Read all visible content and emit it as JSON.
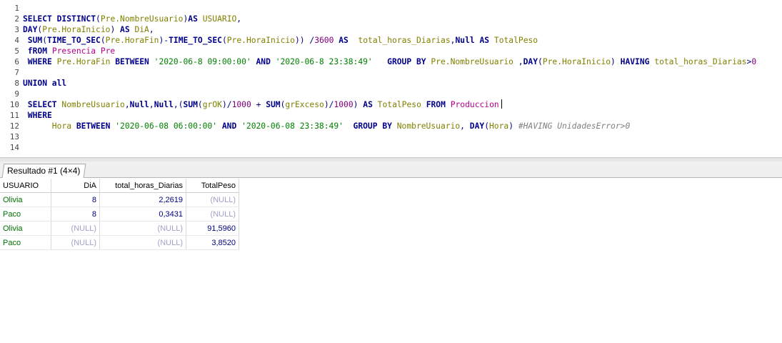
{
  "editor": {
    "line_numbers": [
      "1",
      "2",
      "3",
      "4",
      "5",
      "6",
      "7",
      "8",
      "9",
      "10",
      "11",
      "12",
      "13",
      "14"
    ],
    "lines": [
      [],
      [
        {
          "t": "SELECT ",
          "c": "kw"
        },
        {
          "t": "DISTINCT",
          "c": "kw"
        },
        {
          "t": "(",
          "c": "op"
        },
        {
          "t": "Pre.NombreUsuario",
          "c": "id"
        },
        {
          "t": ")",
          "c": "op"
        },
        {
          "t": "AS ",
          "c": "kw"
        },
        {
          "t": "USUARIO",
          "c": "id"
        },
        {
          "t": ",",
          "c": "op"
        }
      ],
      [
        {
          "t": "DAY",
          "c": "kw"
        },
        {
          "t": "(",
          "c": "op"
        },
        {
          "t": "Pre.HoraInicio",
          "c": "id"
        },
        {
          "t": ") ",
          "c": "op"
        },
        {
          "t": "AS ",
          "c": "kw"
        },
        {
          "t": "DiA",
          "c": "id"
        },
        {
          "t": ",",
          "c": "op"
        }
      ],
      [
        {
          "t": " SUM",
          "c": "kw"
        },
        {
          "t": "(",
          "c": "op"
        },
        {
          "t": "TIME_TO_SEC",
          "c": "kw"
        },
        {
          "t": "(",
          "c": "op"
        },
        {
          "t": "Pre.HoraFin",
          "c": "id"
        },
        {
          "t": ")-",
          "c": "op"
        },
        {
          "t": "TIME_TO_SEC",
          "c": "kw"
        },
        {
          "t": "(",
          "c": "op"
        },
        {
          "t": "Pre.HoraInicio",
          "c": "id"
        },
        {
          "t": ")) /",
          "c": "op"
        },
        {
          "t": "3600 ",
          "c": "num"
        },
        {
          "t": "AS  ",
          "c": "kw"
        },
        {
          "t": "total_horas_Diarias",
          "c": "id"
        },
        {
          "t": ",",
          "c": "op"
        },
        {
          "t": "Null ",
          "c": "kw"
        },
        {
          "t": "AS ",
          "c": "kw"
        },
        {
          "t": "TotalPeso",
          "c": "id"
        }
      ],
      [
        {
          "t": " fROM ",
          "c": "kw"
        },
        {
          "t": "Presencia Pre",
          "c": "tb"
        }
      ],
      [
        {
          "t": " WHERE ",
          "c": "kw"
        },
        {
          "t": "Pre.HoraFin ",
          "c": "id"
        },
        {
          "t": "BETWEEN ",
          "c": "kw"
        },
        {
          "t": "'2020-06-8 09:00:00'",
          "c": "str"
        },
        {
          "t": " AND ",
          "c": "kw"
        },
        {
          "t": "'2020-06-8 23:38:49'",
          "c": "str"
        },
        {
          "t": "   GROUP BY ",
          "c": "kw"
        },
        {
          "t": "Pre.NombreUsuario ",
          "c": "id"
        },
        {
          "t": ",",
          "c": "op"
        },
        {
          "t": "DAY",
          "c": "kw"
        },
        {
          "t": "(",
          "c": "op"
        },
        {
          "t": "Pre.HoraInicio",
          "c": "id"
        },
        {
          "t": ") ",
          "c": "op"
        },
        {
          "t": "HAVING ",
          "c": "kw"
        },
        {
          "t": "total_horas_Diarias",
          "c": "id"
        },
        {
          "t": ">",
          "c": "op"
        },
        {
          "t": "0",
          "c": "num"
        }
      ],
      [],
      [
        {
          "t": "UNION all",
          "c": "kw"
        }
      ],
      [],
      [
        {
          "t": " SELECT ",
          "c": "kw"
        },
        {
          "t": "NombreUsuario",
          "c": "id"
        },
        {
          "t": ",",
          "c": "op"
        },
        {
          "t": "Null",
          "c": "kw"
        },
        {
          "t": ",",
          "c": "op"
        },
        {
          "t": "Null",
          "c": "kw"
        },
        {
          "t": ",(",
          "c": "op"
        },
        {
          "t": "SUM",
          "c": "kw"
        },
        {
          "t": "(",
          "c": "op"
        },
        {
          "t": "grOK",
          "c": "id"
        },
        {
          "t": ")/",
          "c": "op"
        },
        {
          "t": "1000",
          "c": "num"
        },
        {
          "t": " + ",
          "c": "op"
        },
        {
          "t": "SUM",
          "c": "kw"
        },
        {
          "t": "(",
          "c": "op"
        },
        {
          "t": "grExceso",
          "c": "id"
        },
        {
          "t": ")/",
          "c": "op"
        },
        {
          "t": "1000",
          "c": "num"
        },
        {
          "t": ") ",
          "c": "op"
        },
        {
          "t": "AS ",
          "c": "kw"
        },
        {
          "t": "TotalPeso ",
          "c": "id"
        },
        {
          "t": "FROM ",
          "c": "kw"
        },
        {
          "t": "Produccion",
          "c": "tb"
        }
      ],
      [
        {
          "t": " WHERE",
          "c": "kw"
        }
      ],
      [
        {
          "t": "      Hora ",
          "c": "id"
        },
        {
          "t": "BETWEEN ",
          "c": "kw"
        },
        {
          "t": "'2020-06-08 06:00:00'",
          "c": "str"
        },
        {
          "t": " AND ",
          "c": "kw"
        },
        {
          "t": "'2020-06-08 23:38:49'",
          "c": "str"
        },
        {
          "t": "  GROUP BY ",
          "c": "kw"
        },
        {
          "t": "NombreUsuario",
          "c": "id"
        },
        {
          "t": ", ",
          "c": "op"
        },
        {
          "t": "DAY",
          "c": "kw"
        },
        {
          "t": "(",
          "c": "op"
        },
        {
          "t": "Hora",
          "c": "id"
        },
        {
          "t": ") ",
          "c": "op"
        },
        {
          "t": "#HAVING UnidadesError>0",
          "c": "cm"
        }
      ],
      [],
      []
    ],
    "caret_line": 10
  },
  "results": {
    "tab_label": "Resultado #1 (4×4)",
    "columns": [
      "USUARIO",
      "DiA",
      "total_horas_Diarias",
      "TotalPeso"
    ],
    "rows": [
      [
        "Olivia",
        "8",
        "2,2619",
        "(NULL)"
      ],
      [
        "Paco",
        "8",
        "0,3431",
        "(NULL)"
      ],
      [
        "Olivia",
        "(NULL)",
        "(NULL)",
        "91,5960"
      ],
      [
        "Paco",
        "(NULL)",
        "(NULL)",
        "3,8520"
      ]
    ]
  },
  "colors": {
    "keyword": "#00008b",
    "identifier": "#808000",
    "table": "#b5008c",
    "string": "#008000",
    "number": "#800080",
    "comment": "#808080",
    "text_value": "#007000",
    "null_value": "#a0a0c8"
  }
}
